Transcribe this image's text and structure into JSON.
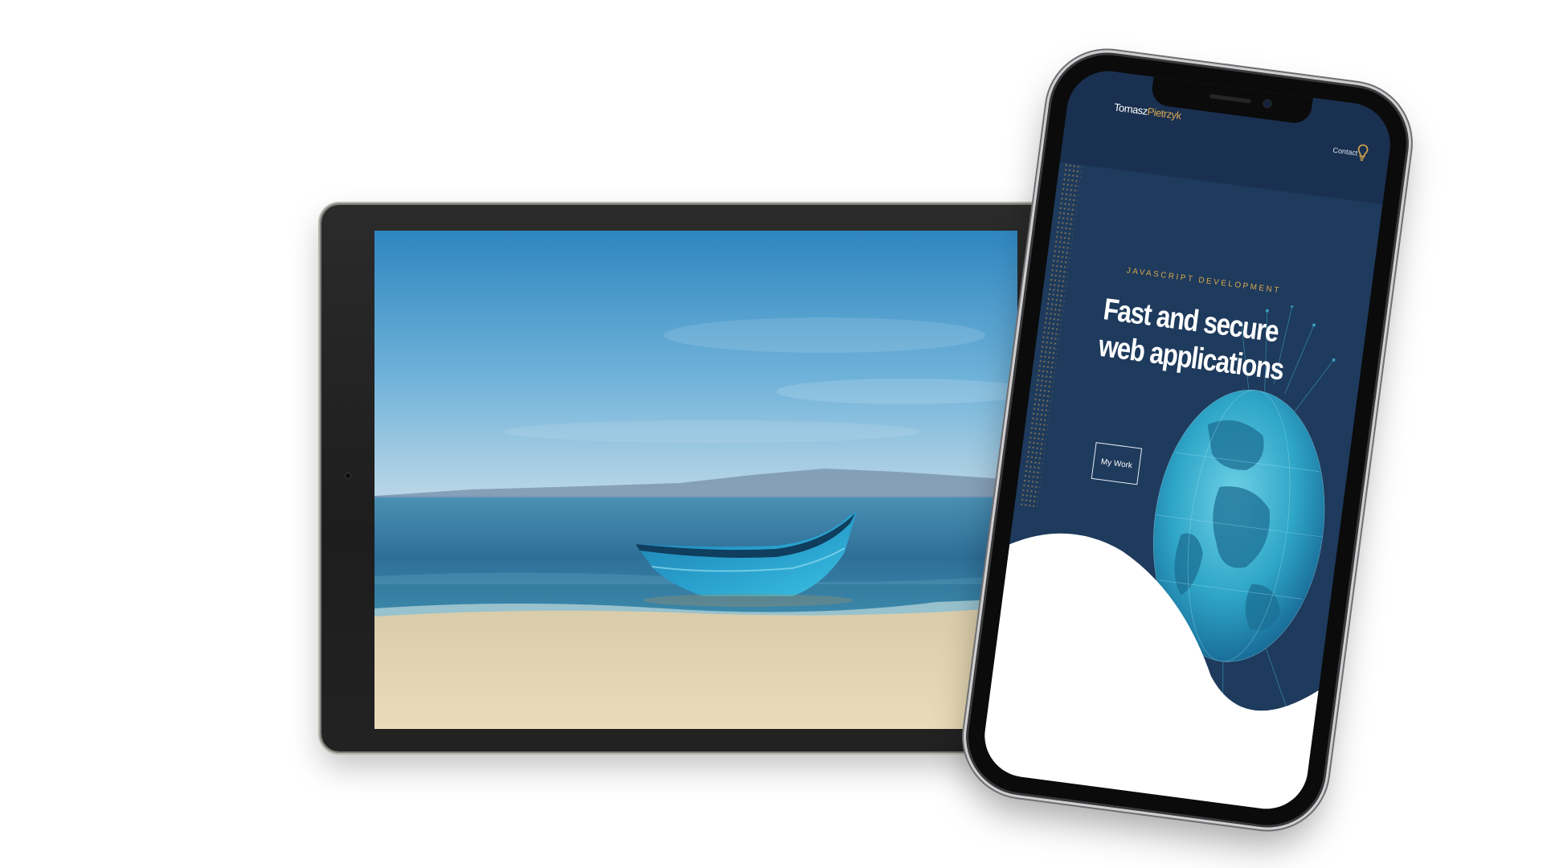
{
  "colors": {
    "page_background": "#ffffff",
    "site_navy": "#1e3a5c",
    "site_header_navy": "#1a3050",
    "accent_gold": "#d9a84e",
    "globe_teal": "#2fa6c8",
    "boat_blue": "#2aa3cf"
  },
  "tablet": {
    "screen_content": "beach-with-blue-boat-photo"
  },
  "phone": {
    "header": {
      "brand_first": "Tomasz",
      "brand_last": "Pietrzyk",
      "nav_contact": "Contact",
      "nav_icon": "lightbulb-icon"
    },
    "hero": {
      "eyebrow": "JAVASCRIPT DEVELOPMENT",
      "title_line1": "Fast and secure",
      "title_line2": "web applications",
      "cta_label": "My Work",
      "illustration": "digital-globe-illustration"
    }
  }
}
